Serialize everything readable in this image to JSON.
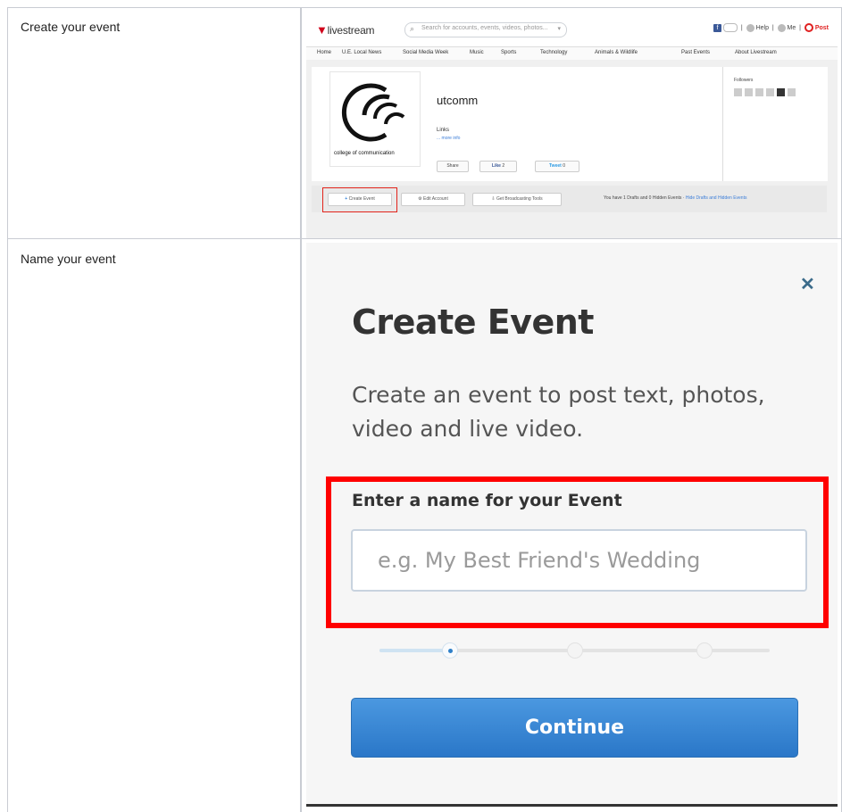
{
  "rows": [
    {
      "label": "Create your event"
    },
    {
      "label": "Name your event"
    }
  ],
  "livestream": {
    "logo": "livestream",
    "search_placeholder": "Search for accounts, events, videos, photos...",
    "header_links": [
      "Help",
      "Me",
      "Post"
    ],
    "nav": [
      "Home",
      "U.E. Local News",
      "Social Media Week",
      "Music",
      "Sports",
      "Technology",
      "Animals & Wildlife",
      "Past Events",
      "About Livestream"
    ],
    "channel_name": "utcomm",
    "channel_sub": "Links",
    "channel_more": "... more info",
    "share_label": "Share",
    "like_label": "Like",
    "like_count": "2",
    "tweet_label": "Tweet",
    "tweet_count": "0",
    "logo_caption": "college of communication",
    "side_title": "Followers",
    "actions": {
      "create_event": "Create Event",
      "edit_account": "Edit Account",
      "get_tools": "Get Broadcasting Tools"
    },
    "drafts_text": "You have 1 Drafts and 0 Hidden Events",
    "drafts_link": "Hide Drafts and Hidden Events"
  },
  "modal": {
    "close_icon": "close-icon",
    "title": "Create Event",
    "description": "Create an event to post text, photos, video and live video.",
    "field_label": "Enter a name for your Event",
    "field_placeholder": "e.g. My Best Friend's Wedding",
    "field_value": "",
    "steps_total": 3,
    "steps_current": 1,
    "continue_label": "Continue",
    "highlight_color": "#ff0000",
    "button_color": "#3a87d4"
  }
}
